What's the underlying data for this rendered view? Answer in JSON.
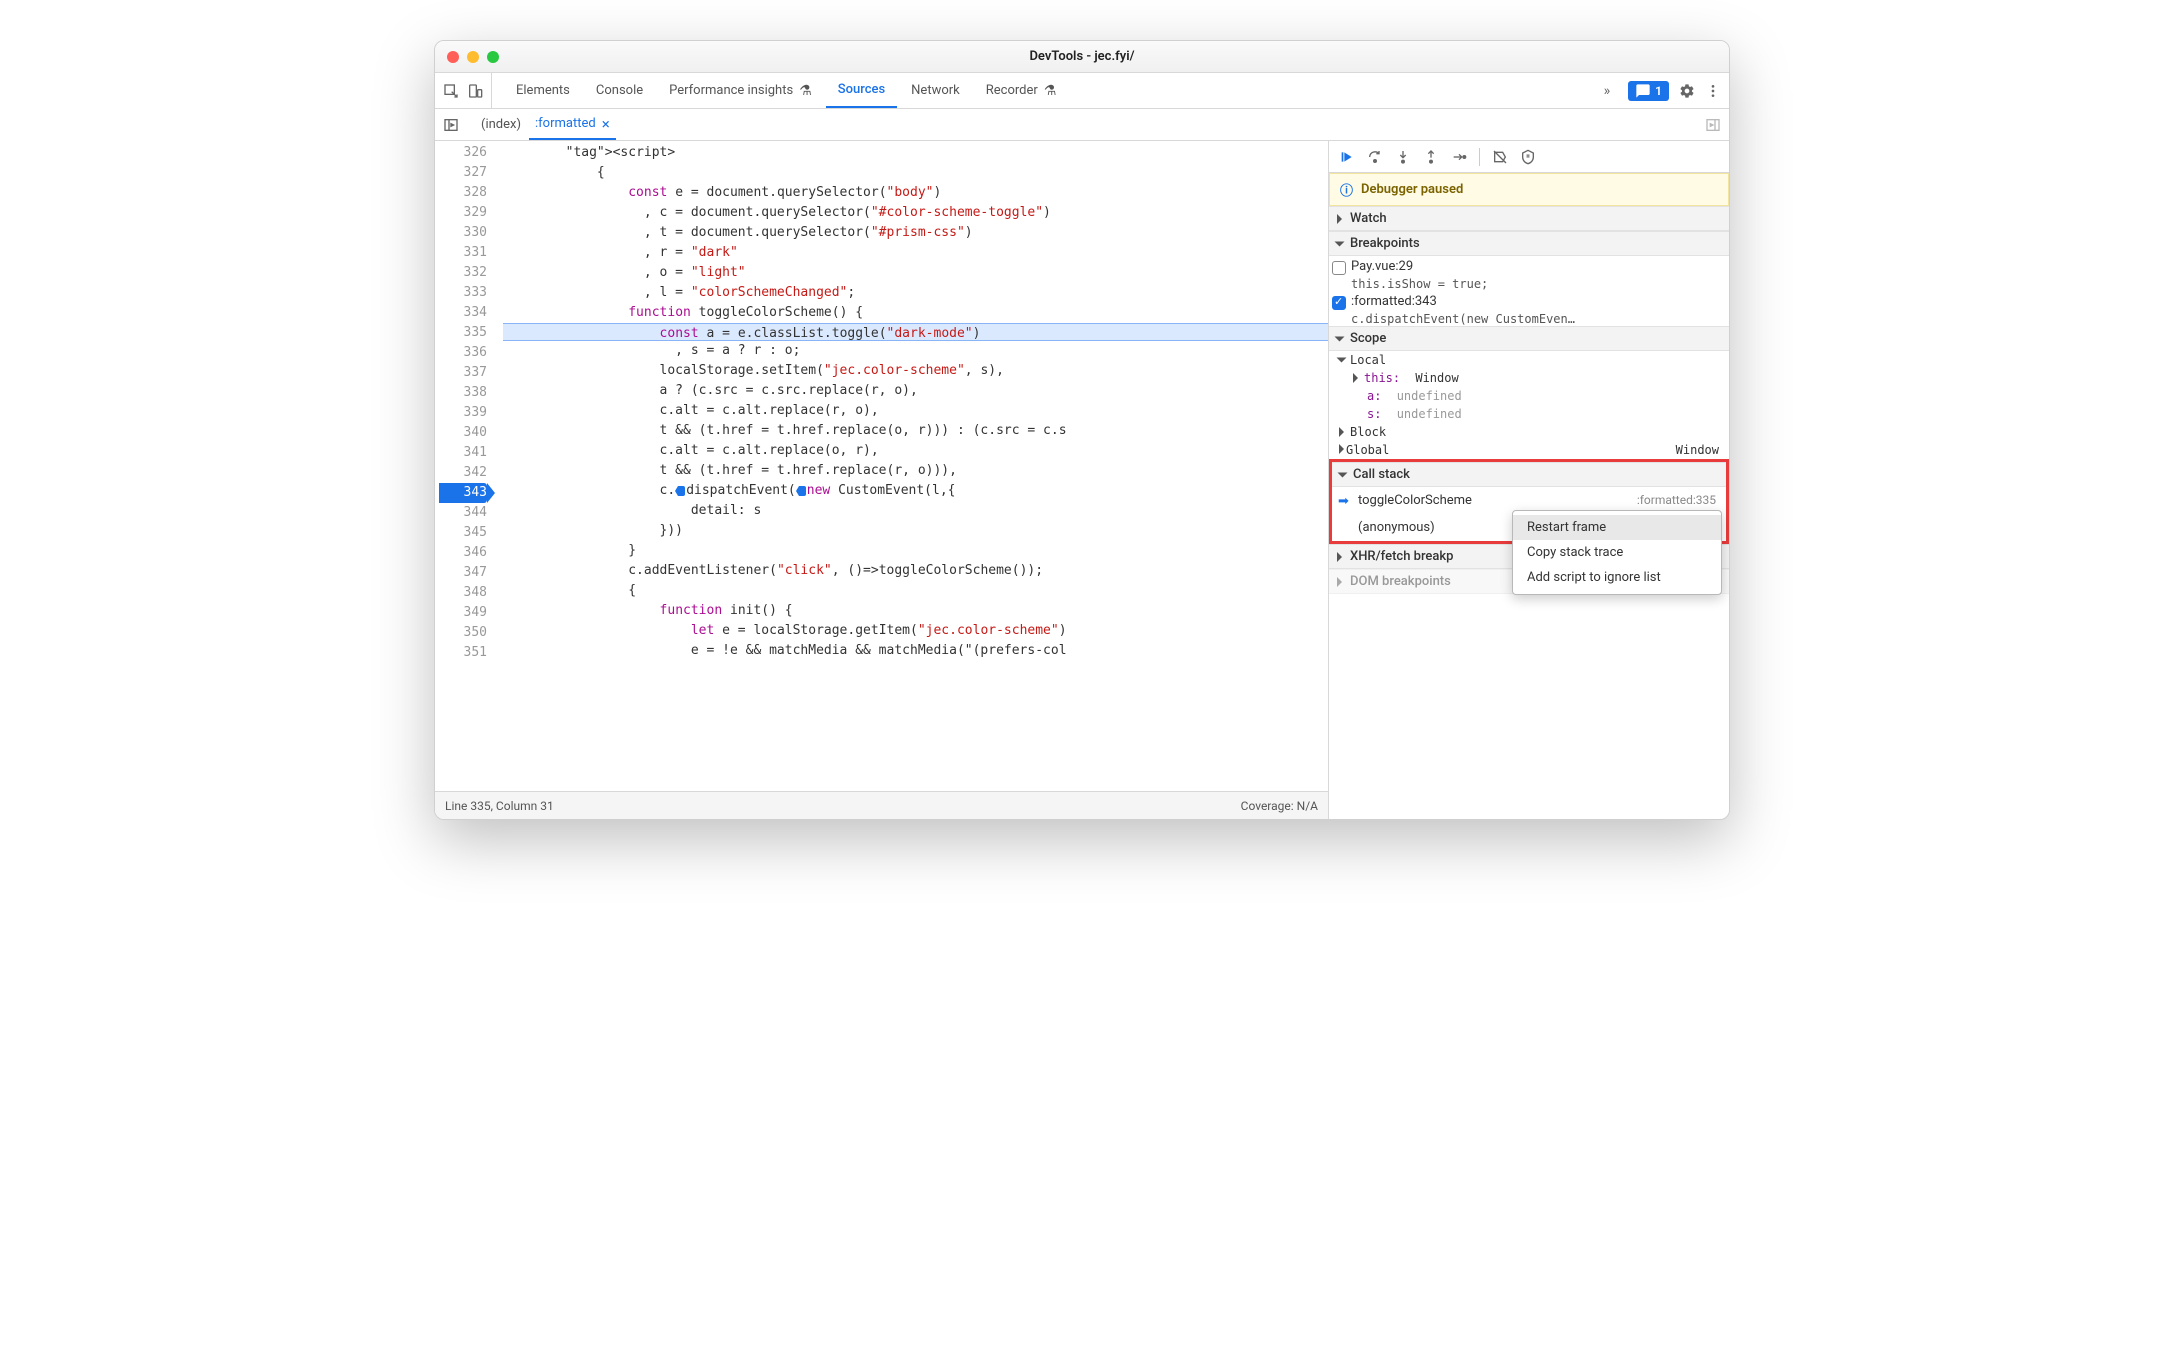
{
  "window": {
    "title": "DevTools - jec.fyi/"
  },
  "mainTabs": {
    "items": [
      "Elements",
      "Console",
      "Performance insights",
      "Sources",
      "Network",
      "Recorder"
    ],
    "experiments": [
      2,
      5
    ],
    "active": "Sources",
    "issuesBadge": "1"
  },
  "fileTabs": {
    "items": [
      "(index)",
      ":formatted"
    ],
    "active": ":formatted"
  },
  "code": {
    "startLine": 326,
    "highlightLine": 335,
    "bpLine": 343,
    "lines": [
      "        <script>",
      "            {",
      "                const e = document.querySelector(\"body\")",
      "                  , c = document.querySelector(\"#color-scheme-toggle\")",
      "                  , t = document.querySelector(\"#prism-css\")",
      "                  , r = \"dark\"",
      "                  , o = \"light\"",
      "                  , l = \"colorSchemeChanged\";",
      "                function toggleColorScheme() {",
      "                    const a = e.classList.toggle(\"dark-mode\")",
      "                      , s = a ? r : o;",
      "                    localStorage.setItem(\"jec.color-scheme\", s),",
      "                    a ? (c.src = c.src.replace(r, o),",
      "                    c.alt = c.alt.replace(r, o),",
      "                    t && (t.href = t.href.replace(o, r))) : (c.src = c.s",
      "                    c.alt = c.alt.replace(o, r),",
      "                    t && (t.href = t.href.replace(r, o))),",
      "                    c.dispatchEvent(new CustomEvent(l,{",
      "                        detail: s",
      "                    }))",
      "                }",
      "                c.addEventListener(\"click\", ()=>toggleColorScheme());",
      "                {",
      "                    function init() {",
      "                        let e = localStorage.getItem(\"jec.color-scheme\")",
      "                        e = !e && matchMedia && matchMedia(\"(prefers-col"
    ]
  },
  "statusbar": {
    "position": "Line 335, Column 31",
    "coverage": "Coverage: N/A"
  },
  "debug": {
    "banner": "Debugger paused",
    "sections": {
      "watch": "Watch",
      "breakpoints": "Breakpoints",
      "scope": "Scope",
      "callstack": "Call stack",
      "xhr": "XHR/fetch breakp",
      "dom": "DOM breakpoints"
    },
    "breakpoints": [
      {
        "checked": false,
        "label": "Pay.vue:29",
        "sub": "this.isShow = true;"
      },
      {
        "checked": true,
        "label": ":formatted:343",
        "sub": "c.dispatchEvent(new CustomEven…"
      }
    ],
    "scope": {
      "local": {
        "label": "Local",
        "this_label": "this:",
        "this_val": "Window",
        "a": {
          "name": "a:",
          "val": "undefined"
        },
        "s": {
          "name": "s:",
          "val": "undefined"
        }
      },
      "block": "Block",
      "global": "Global",
      "global_val": "Window"
    },
    "callstack": [
      {
        "name": "toggleColorScheme",
        "location": ":formatted:335",
        "current": true
      },
      {
        "name": "(anonymous)",
        "location": ""
      }
    ],
    "contextMenu": [
      "Restart frame",
      "Copy stack trace",
      "Add script to ignore list"
    ]
  }
}
